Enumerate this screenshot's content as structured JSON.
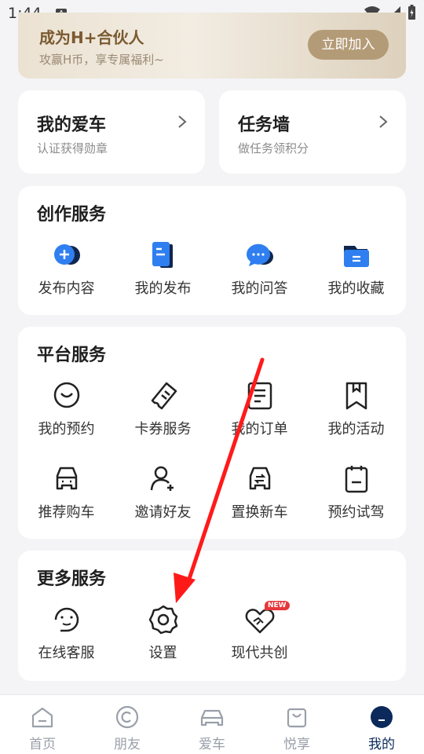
{
  "status": {
    "time": "1:44",
    "notify_letter": "A"
  },
  "banner": {
    "title": "成为H+合伙人",
    "subtitle": "攻赢H币，享专属福利~",
    "join_label": "立即加入"
  },
  "my_car": {
    "title": "我的爱车",
    "subtitle": "认证获得勋章"
  },
  "task_wall": {
    "title": "任务墙",
    "subtitle": "做任务领积分"
  },
  "creation": {
    "title": "创作服务",
    "items": [
      {
        "label": "发布内容",
        "icon": "publish-plus-icon"
      },
      {
        "label": "我的发布",
        "icon": "document-icon"
      },
      {
        "label": "我的问答",
        "icon": "chat-bubble-icon"
      },
      {
        "label": "我的收藏",
        "icon": "folder-icon"
      }
    ]
  },
  "platform": {
    "title": "平台服务",
    "items": [
      {
        "label": "我的预约",
        "icon": "clock-icon"
      },
      {
        "label": "卡券服务",
        "icon": "ticket-icon"
      },
      {
        "label": "我的订单",
        "icon": "order-list-icon"
      },
      {
        "label": "我的活动",
        "icon": "bookmark-icon"
      },
      {
        "label": "推荐购车",
        "icon": "car-front-icon"
      },
      {
        "label": "邀请好友",
        "icon": "add-user-icon"
      },
      {
        "label": "置换新车",
        "icon": "car-swap-icon"
      },
      {
        "label": "预约试驾",
        "icon": "calendar-icon"
      }
    ]
  },
  "more": {
    "title": "更多服务",
    "items": [
      {
        "label": "在线客服",
        "icon": "headset-chat-icon"
      },
      {
        "label": "设置",
        "icon": "gear-icon"
      },
      {
        "label": "现代共创",
        "icon": "heart-handshake-icon",
        "badge": "NEW"
      }
    ]
  },
  "tabbar": {
    "items": [
      {
        "label": "首页",
        "icon": "home-icon",
        "active": false
      },
      {
        "label": "朋友",
        "icon": "circle-c-icon",
        "active": false
      },
      {
        "label": "爱车",
        "icon": "car-icon",
        "active": false
      },
      {
        "label": "悦享",
        "icon": "shopping-bag-icon",
        "active": false
      },
      {
        "label": "我的",
        "icon": "profile-avatar-icon",
        "active": true
      }
    ]
  },
  "colors": {
    "accent_blue": "#2f7ff0",
    "dark_navy": "#0b2a5b",
    "gold": "#b49b77",
    "annotation_red": "#ff1a1a"
  }
}
